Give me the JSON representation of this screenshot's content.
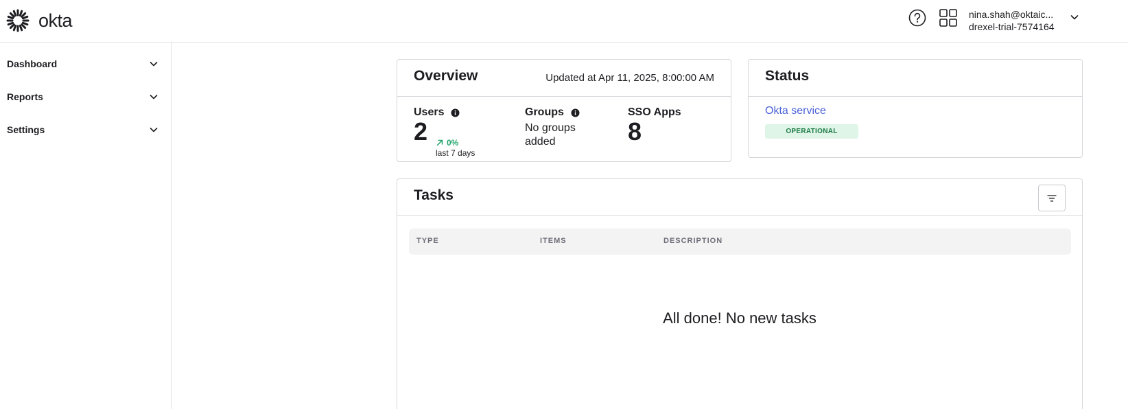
{
  "header": {
    "logo_text": "okta",
    "user_email": "nina.shah@oktaic...",
    "user_org": "drexel-trial-7574164"
  },
  "sidebar": {
    "items": [
      {
        "label": "Dashboard"
      },
      {
        "label": "Reports"
      },
      {
        "label": "Settings"
      }
    ]
  },
  "overview": {
    "title": "Overview",
    "updated": "Updated at Apr 11, 2025, 8:00:00 AM",
    "users_label": "Users",
    "users_value": "2",
    "users_trend": "0%",
    "users_trend_sub": "last 7 days",
    "groups_label": "Groups",
    "groups_value": "No groups added",
    "sso_label": "SSO Apps",
    "sso_value": "8"
  },
  "status": {
    "title": "Status",
    "service": "Okta service",
    "badge": "OPERATIONAL"
  },
  "tasks": {
    "title": "Tasks",
    "columns": [
      "TYPE",
      "ITEMS",
      "DESCRIPTION"
    ],
    "empty_message": "All done! No new tasks"
  },
  "colors": {
    "accent_link": "#4a62d8",
    "trend_green": "#1fa36a",
    "badge_bg": "#dff5e8",
    "badge_text": "#1c7a44"
  }
}
